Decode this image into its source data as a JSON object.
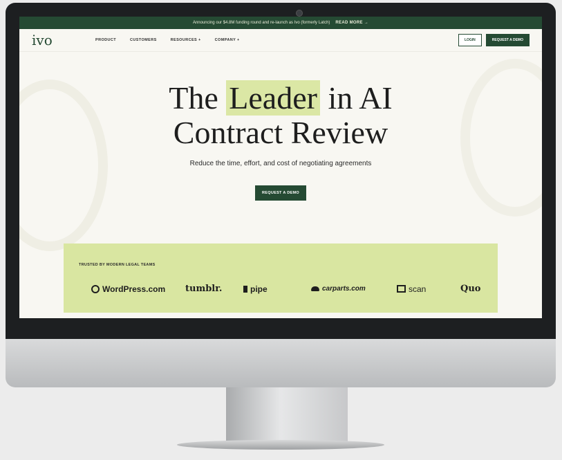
{
  "banner": {
    "text": "Announcing our $4.8M funding round and re-launch as Ivo (formerly Latch)",
    "link": "READ MORE →"
  },
  "nav": {
    "logo": "ivo",
    "links": [
      "PRODUCT",
      "CUSTOMERS",
      "RESOURCES +",
      "COMPANY +"
    ],
    "login": "LOGIN",
    "demo": "REQUEST A DEMO"
  },
  "hero": {
    "title_pre": "The",
    "title_highlight": "Leader",
    "title_post": "in AI",
    "title_line2": "Contract Review",
    "subtitle": "Reduce the time, effort, and cost of negotiating agreements",
    "cta": "REQUEST A DEMO"
  },
  "trusted": {
    "label": "TRUSTED BY MODERN LEGAL TEAMS",
    "logos": [
      "WordPress.com",
      "tumblr.",
      "pipe",
      "carparts.com",
      "scan",
      "Quo"
    ]
  },
  "colors": {
    "brand_green": "#254a33",
    "highlight": "#dbe7a5",
    "trusted_bg": "#d9e6a1"
  }
}
